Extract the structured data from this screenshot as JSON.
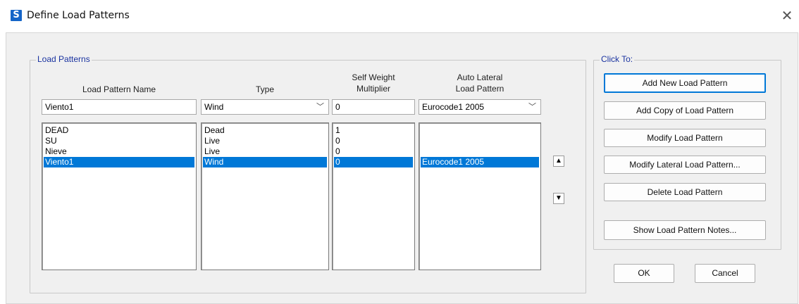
{
  "window": {
    "title": "Define Load Patterns",
    "logo_letter": "S",
    "close_glyph": "✕"
  },
  "load_patterns": {
    "group_title": "Load Patterns",
    "headers": {
      "name": "Load Pattern Name",
      "type": "Type",
      "self_weight_1": "Self Weight",
      "self_weight_2": "Multiplier",
      "auto_lateral_1": "Auto Lateral",
      "auto_lateral_2": "Load Pattern"
    },
    "edit_row": {
      "name": "Viento1",
      "type": "Wind",
      "multiplier": "0",
      "auto_lateral": "Eurocode1 2005"
    },
    "rows": [
      {
        "name": "DEAD",
        "type": "Dead",
        "multiplier": "1",
        "auto_lateral": ""
      },
      {
        "name": "SU",
        "type": "Live",
        "multiplier": "0",
        "auto_lateral": ""
      },
      {
        "name": "Nieve",
        "type": "Live",
        "multiplier": "0",
        "auto_lateral": ""
      },
      {
        "name": "Viento1",
        "type": "Wind",
        "multiplier": "0",
        "auto_lateral": "Eurocode1 2005"
      }
    ],
    "selected_row": 3,
    "move_up_glyph": "▲",
    "move_down_glyph": "▼"
  },
  "click_to": {
    "group_title": "Click To:",
    "add_new": "Add New Load Pattern",
    "add_copy": "Add Copy of Load Pattern",
    "modify": "Modify Load Pattern",
    "modify_lateral": "Modify Lateral Load Pattern...",
    "delete": "Delete Load Pattern",
    "show_notes": "Show Load Pattern Notes..."
  },
  "footer": {
    "ok": "OK",
    "cancel": "Cancel"
  },
  "colors": {
    "selection": "#0078d7",
    "group_title": "#1a33a0",
    "logo": "#1565c8"
  }
}
